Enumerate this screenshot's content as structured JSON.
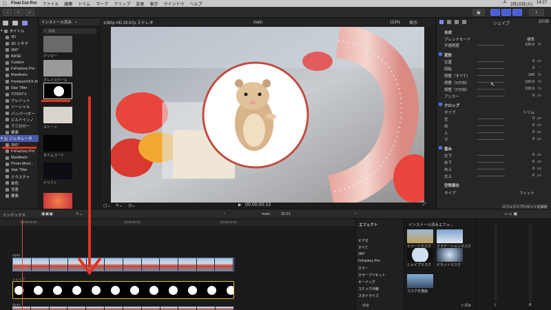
{
  "menubar": {
    "app": "Final Cut Pro",
    "items": [
      "ファイル",
      "編集",
      "トリム",
      "マーク",
      "クリップ",
      "変更",
      "表示",
      "ウインドウ",
      "ヘルプ"
    ],
    "status": [
      "A",
      "2月15日(火)",
      "14:17"
    ]
  },
  "sidebar": {
    "sections": [
      {
        "label": "タイトル",
        "head": true
      },
      {
        "label": "3D"
      },
      {
        "label": "3D シネマ"
      },
      {
        "label": "360°"
      },
      {
        "label": "BASE"
      },
      {
        "label": "Custom"
      },
      {
        "label": "FxFactory Pro"
      },
      {
        "label": "Manifesto"
      },
      {
        "label": "PremiumVFX Al"
      },
      {
        "label": "Star Titler"
      },
      {
        "label": "TOSSY's"
      },
      {
        "label": "クレジット"
      },
      {
        "label": "ソーシャル"
      },
      {
        "label": "バンパー/オー"
      },
      {
        "label": "ビルドインノ"
      },
      {
        "label": "下三分の一"
      },
      {
        "label": "要素"
      },
      {
        "label": "ジェネレータ",
        "head": true,
        "selected": true
      },
      {
        "label": "360°"
      },
      {
        "label": "FxFactory Pro"
      },
      {
        "label": "Manifesto"
      },
      {
        "label": "Photo Mont..."
      },
      {
        "label": "Star Titler"
      },
      {
        "label": "テクスチャ"
      },
      {
        "label": "単色"
      },
      {
        "label": "背景"
      },
      {
        "label": "要素"
      }
    ]
  },
  "browser": {
    "header": "インストール済み",
    "search_placeholder": "検索",
    "thumbs": [
      {
        "label": "グリマー",
        "color": "#6a6a6a"
      },
      {
        "label": "グレイスケール",
        "color": "#9a9a9a"
      },
      {
        "label": "",
        "color": "#000000"
      },
      {
        "label": "ストーン",
        "color": "#d8d4cc"
      },
      {
        "label": "タイムコード",
        "color": "#050505"
      },
      {
        "label": "ドリフト",
        "color": "#0d0d14"
      },
      {
        "label": "",
        "color": "#d7463a"
      }
    ]
  },
  "viewer": {
    "format": "1080p HD 29.97p ステレオ",
    "title": "main",
    "zoom": "113%",
    "display": "表示",
    "timecode": "00:00:00:13"
  },
  "inspector": {
    "title": "シェイプ",
    "duration": "10:05",
    "composite": "合成",
    "blend_label": "ブレンドモード",
    "blend_value": "標準",
    "opacity_label": "不透明度",
    "opacity_value": "100.0",
    "transform": "変形",
    "position": "位置",
    "rotation": "回転",
    "scale_all": "調整（すべて）",
    "scale_x": "調整（X方向）",
    "scale_y": "調整（Y方向）",
    "anchor": "アンカー",
    "crop": "クロップ",
    "crop_type": "タイプ",
    "crop_type_value": "トリム",
    "crop_left": "左",
    "crop_right": "右",
    "crop_top": "上",
    "crop_bottom": "下",
    "distort": "歪み",
    "bottom_left": "左下",
    "bottom_right": "右下",
    "top_right": "右上",
    "top_left": "左上",
    "space": "空間適合",
    "space_type": "タイプ",
    "space_value": "フィット",
    "save_preset": "エフェクトプリセットを保存",
    "values": {
      "pos_x": "0",
      "pos_y": "0",
      "rot": "0",
      "scale_all": "100",
      "scale_x": "100.0",
      "scale_y": "100.0",
      "anchor_x": "0",
      "anchor_y": "0",
      "crop": "0",
      "distort_x": "0",
      "distort_y": "0"
    },
    "units": {
      "px": "px",
      "pct": "%",
      "deg": "°"
    }
  },
  "timeline": {
    "index": "インデックス",
    "project": "main",
    "duration": "32:21",
    "ruler_start": "00:00:00:00",
    "ruler_mid": "00:00:05:00",
    "ruler_end": "00:00:10:00",
    "clip1_label": "clip01",
    "clip2_label": "シェイプ",
    "clip3_label": "clip01"
  },
  "effects": {
    "header": "エフェクト",
    "installed": "インストール済みエフェ...",
    "categories": [
      "ビデオ",
      "すべて",
      "360°",
      "FxFactory Pro",
      "カラー",
      "カラープリセット",
      "キーイング",
      "コミック外観",
      "スタイライズ"
    ],
    "items": [
      "イメージマスク",
      "グラデーションマスク",
      "シェイプマスク",
      "ビネットマスク",
      "マスクを描画"
    ],
    "count": "5 項目",
    "search_placeholder": "検索"
  },
  "meters": {
    "left": "L",
    "right": "R"
  },
  "colors": {
    "accent": "#4a5fd6",
    "annotation": "#e8311f",
    "shape_clip": "#000000"
  }
}
